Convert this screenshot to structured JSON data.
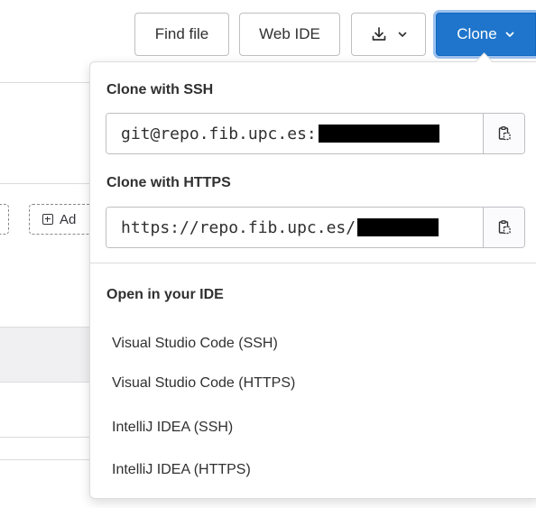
{
  "toolbar": {
    "find_file_label": "Find file",
    "web_ide_label": "Web IDE",
    "clone_label": "Clone"
  },
  "background": {
    "add_button_label": "Ad"
  },
  "clone_dropdown": {
    "ssh_title": "Clone with SSH",
    "ssh_url": "git@repo.fib.upc.es:",
    "https_title": "Clone with HTTPS",
    "https_url": "https://repo.fib.upc.es/",
    "ide_title": "Open in your IDE",
    "ide_options": [
      "Visual Studio Code (SSH)",
      "Visual Studio Code (HTTPS)",
      "IntelliJ IDEA (SSH)",
      "IntelliJ IDEA (HTTPS)"
    ]
  },
  "colors": {
    "accent": "#1f75cb",
    "border": "#bfbfc3",
    "text": "#303030"
  },
  "icons": [
    "download-icon",
    "chevron-down-icon",
    "clipboard-icon",
    "plus-square-icon"
  ]
}
